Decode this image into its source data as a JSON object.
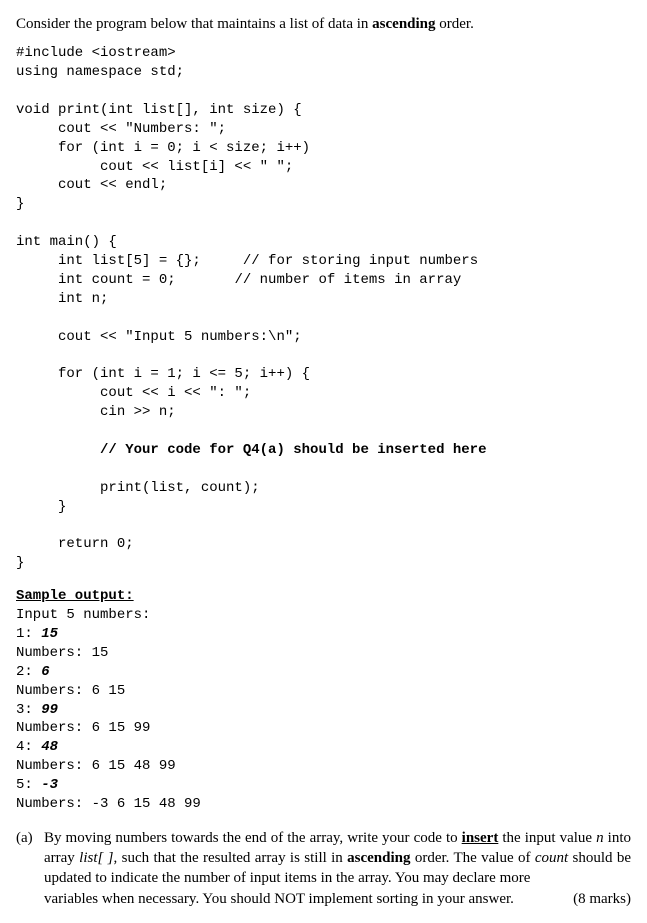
{
  "intro": {
    "prefix": "Consider the program below that maintains a list of data in ",
    "bold": "ascending",
    "suffix": " order."
  },
  "code": {
    "l1": "#include <iostream>",
    "l2": "using namespace std;",
    "l3": "",
    "l4": "void print(int list[], int size) {",
    "l5": "     cout << \"Numbers: \";",
    "l6": "     for (int i = 0; i < size; i++)",
    "l7": "          cout << list[i] << \" \";",
    "l8": "     cout << endl;",
    "l9": "}",
    "l10": "",
    "l11": "int main() {",
    "l12a": "     int list[5] = {};",
    "l12c": "     // for storing input numbers",
    "l13a": "     int count = 0;",
    "l13c": "       // number of items in array",
    "l14": "     int n;",
    "l15": "",
    "l16": "     cout << \"Input 5 numbers:\\n\";",
    "l17": "",
    "l18": "     for (int i = 1; i <= 5; i++) {",
    "l19": "          cout << i << \": \";",
    "l20": "          cin >> n;",
    "l21": "",
    "l22": "          // Your code for Q4(a) should be inserted here",
    "l23": "",
    "l24": "          print(list, count);",
    "l25": "     }",
    "l26": "",
    "l27": "     return 0;",
    "l28": "}"
  },
  "sample": {
    "heading": "Sample output:",
    "s1": "Input 5 numbers:",
    "s2a": "1: ",
    "s2b": "15",
    "s3": "Numbers: 15",
    "s4a": "2: ",
    "s4b": "6",
    "s5": "Numbers: 6 15",
    "s6a": "3: ",
    "s6b": "99",
    "s7": "Numbers: 6 15 99",
    "s8a": "4: ",
    "s8b": "48",
    "s9": "Numbers: 6 15 48 99",
    "s10a": "5: ",
    "s10b": "-3",
    "s11": "Numbers: -3 6 15 48 99"
  },
  "question": {
    "label": "(a)",
    "t1": "By moving numbers towards the end of the array, write your code to ",
    "insert_word": "insert",
    "t2": " the input value ",
    "var_n": "n",
    "t3": " into array ",
    "var_list": "list[ ]",
    "t4": ", such that the resulted array is still in ",
    "asc": "ascending",
    "t5": " order. The value of ",
    "var_count": "count",
    "t6": " should be updated to indicate the number of input items in the array. You may declare more ",
    "t7": "variables when necessary. You should NOT implement sorting in your answer.",
    "marks": "(8 marks)"
  }
}
